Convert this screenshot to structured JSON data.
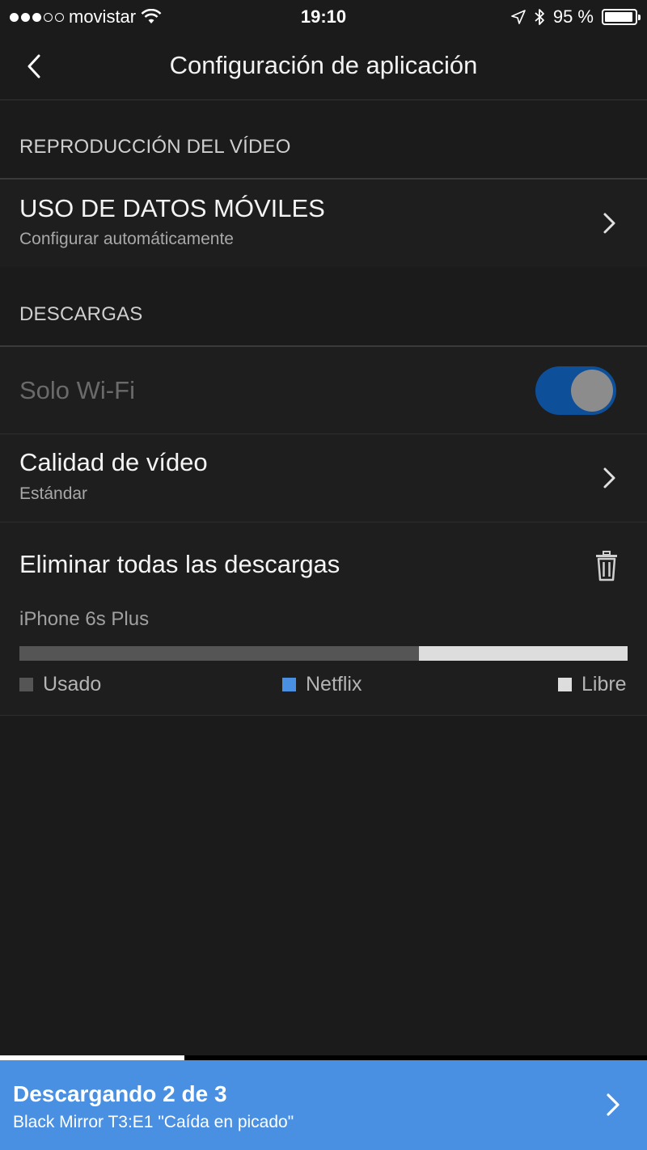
{
  "status_bar": {
    "carrier": "movistar",
    "time": "19:10",
    "battery": "95 %",
    "signal_bars_filled": 3,
    "signal_bars_total": 5
  },
  "header": {
    "title": "Configuración de aplicación"
  },
  "sections": {
    "video_playback": {
      "title": "REPRODUCCIÓN DEL VÍDEO",
      "mobile_data": {
        "title": "USO DE DATOS MÓVILES",
        "subtitle": "Configurar automáticamente"
      }
    },
    "downloads": {
      "title": "DESCARGAS",
      "wifi_only": {
        "label": "Solo Wi-Fi",
        "enabled": true
      },
      "video_quality": {
        "title": "Calidad de vídeo",
        "subtitle": "Estándar"
      },
      "delete_all": {
        "label": "Eliminar todas las descargas"
      }
    }
  },
  "storage": {
    "device": "iPhone 6s Plus",
    "used_fraction": 0.657,
    "netflix_fraction": 0.0,
    "legend": {
      "used": "Usado",
      "netflix": "Netflix",
      "free": "Libre"
    },
    "colors": {
      "used": "#555555",
      "netflix": "#4a90e2",
      "free": "#dddddd"
    }
  },
  "download_banner": {
    "title": "Descargando 2 de 3",
    "subtitle": "Black Mirror T3:E1 \"Caída en picado\"",
    "progress_fraction": 0.285
  },
  "colors": {
    "background": "#1b1b1b",
    "accent": "#4a90e2",
    "toggle_on": "#0e4f9a"
  },
  "icons": [
    "wifi-icon",
    "location-arrow-icon",
    "bluetooth-icon",
    "battery-icon",
    "back-chevron-icon",
    "chevron-right-icon",
    "trash-icon"
  ]
}
